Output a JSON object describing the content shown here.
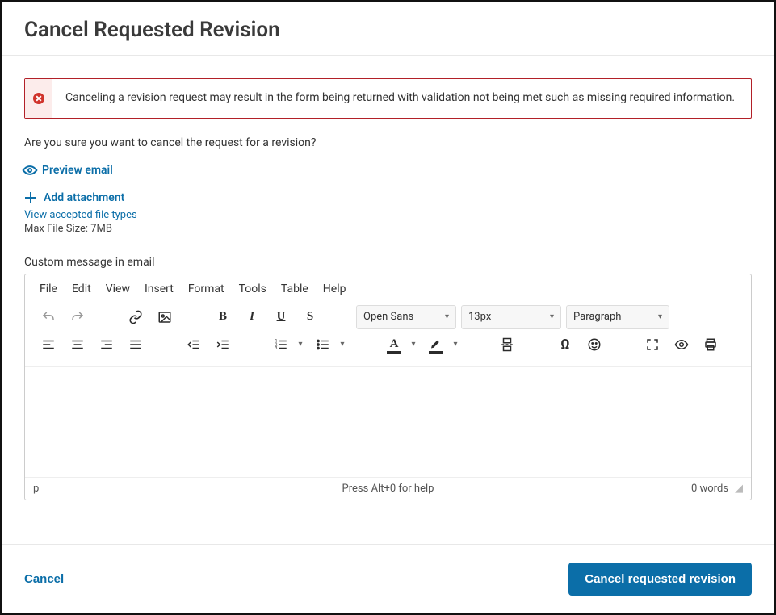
{
  "header": {
    "title": "Cancel Requested Revision"
  },
  "alert": {
    "text": "Canceling a revision request may result in the form being returned with validation not being met such as missing required information."
  },
  "prompt": "Are you sure you want to cancel the request for a revision?",
  "preview_email": {
    "label": "Preview email"
  },
  "attachment": {
    "add_label": "Add attachment",
    "file_types_link": "View accepted file types",
    "max_size": "Max File Size: 7MB"
  },
  "editor": {
    "label": "Custom message in email",
    "menus": [
      "File",
      "Edit",
      "View",
      "Insert",
      "Format",
      "Tools",
      "Table",
      "Help"
    ],
    "font_family": "Open Sans",
    "font_size": "13px",
    "block_format": "Paragraph",
    "status_path": "p",
    "help_hint": "Press Alt+0 for help",
    "word_count": "0 words"
  },
  "footer": {
    "cancel": "Cancel",
    "submit": "Cancel requested revision"
  }
}
